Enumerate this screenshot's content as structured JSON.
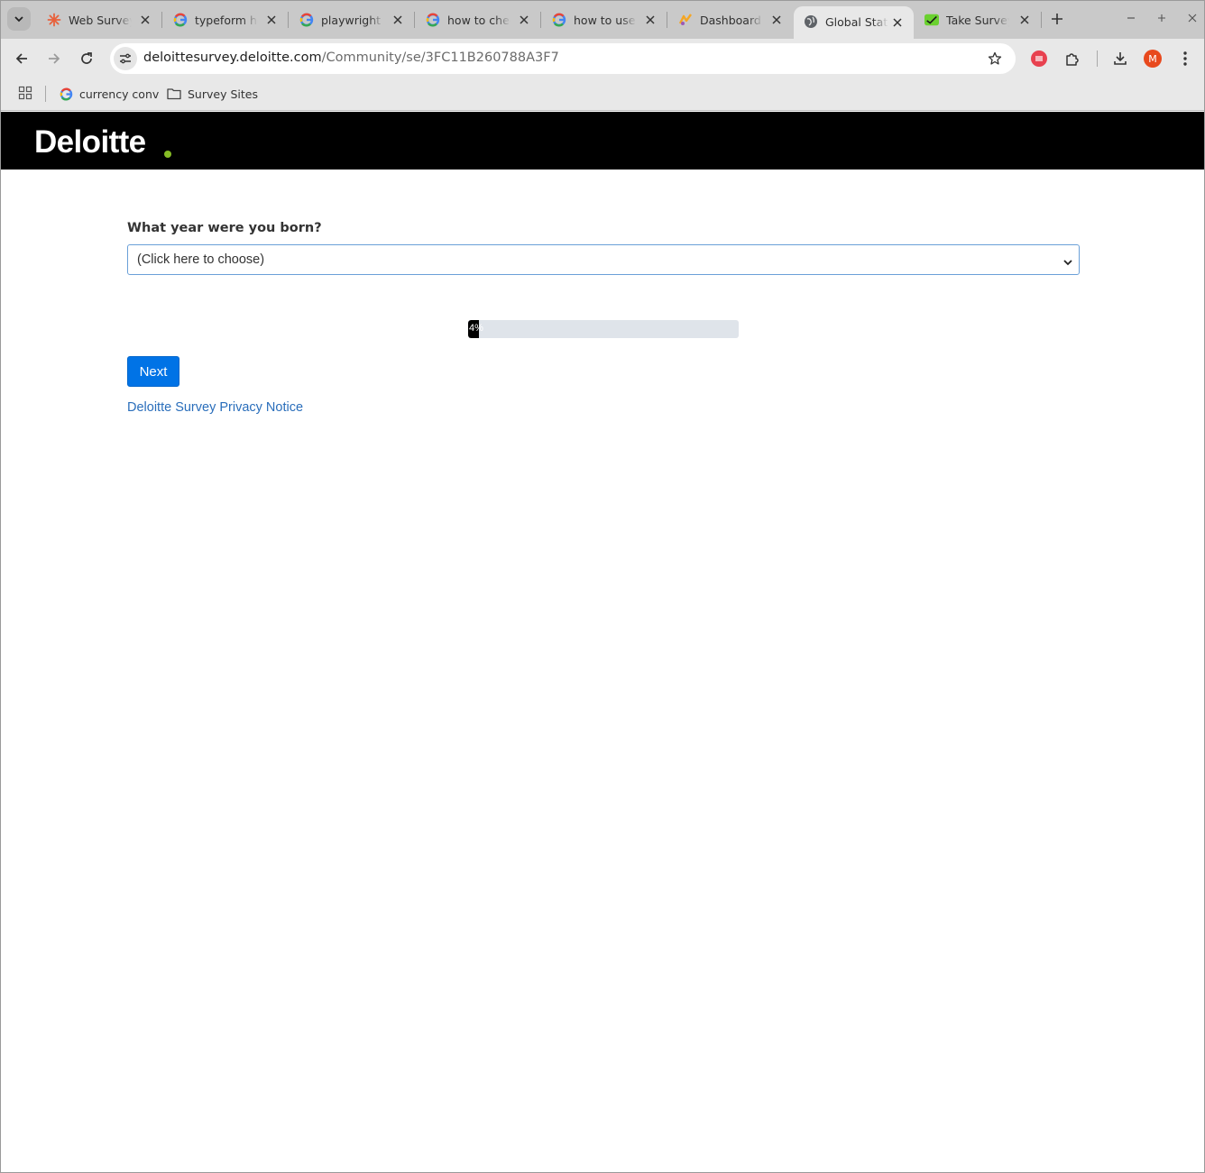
{
  "browser": {
    "tabs": [
      {
        "title": "Web Survey",
        "icon": "asterisk-burst-icon",
        "icon_color": "#e8613c",
        "active": false
      },
      {
        "title": "typeform how",
        "icon": "google-icon",
        "active": false
      },
      {
        "title": "playwright i",
        "icon": "google-icon",
        "active": false
      },
      {
        "title": "how to check",
        "icon": "google-icon",
        "active": false
      },
      {
        "title": "how to use c",
        "icon": "google-icon",
        "active": false
      },
      {
        "title": "Dashboard",
        "icon": "dashboard-icon",
        "icon_color": "#f5a623",
        "active": false
      },
      {
        "title": "Global State",
        "icon": "globe-icon",
        "active": true
      },
      {
        "title": "Take Survey",
        "icon": "survey-check-icon",
        "icon_color": "#6ad12f",
        "active": false
      }
    ],
    "address": {
      "host": "deloittesurvey.deloitte.com",
      "path": "/Community/se/3FC11B260788A3F7"
    },
    "profile_initial": "M",
    "bookmarks": [
      {
        "label": "currency conv",
        "icon": "google-icon"
      },
      {
        "label": "Survey Sites",
        "icon": "folder-icon"
      }
    ]
  },
  "page": {
    "brand": "Deloitte",
    "brand_dot_color": "#86bc25",
    "question": "What year were you born?",
    "select_value": "(Click here to choose)",
    "progress": {
      "percent": 4,
      "label": "4%"
    },
    "next_label": "Next",
    "privacy_link": "Deloitte Survey Privacy Notice"
  }
}
